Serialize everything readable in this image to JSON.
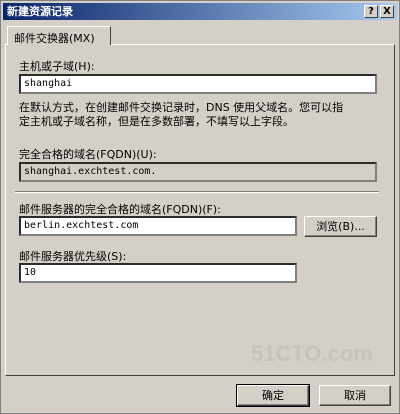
{
  "window": {
    "title": "新建资源记录",
    "help_glyph": "?",
    "close_glyph": "X"
  },
  "tab": {
    "label": "邮件交换器(MX)"
  },
  "host": {
    "label": "主机或子域(H):",
    "value": "shanghai"
  },
  "description": {
    "line1": "在默认方式，在创建邮件交换记录时，DNS 使用父域名。您可以指",
    "line2": "定主机或子域名称，但是在多数部署，不填写以上字段。"
  },
  "fqdn": {
    "label": "完全合格的域名(FQDN)(U):",
    "value": "shanghai.exchtest.com."
  },
  "mail_server": {
    "label": "邮件服务器的完全合格的域名(FQDN)(F):",
    "value": "berlin.exchtest.com",
    "browse_label": "浏览(B)..."
  },
  "priority": {
    "label": "邮件服务器优先级(S):",
    "value": "10"
  },
  "buttons": {
    "ok": "确定",
    "cancel": "取消"
  },
  "watermark": {
    "text": "51CTO.com"
  }
}
